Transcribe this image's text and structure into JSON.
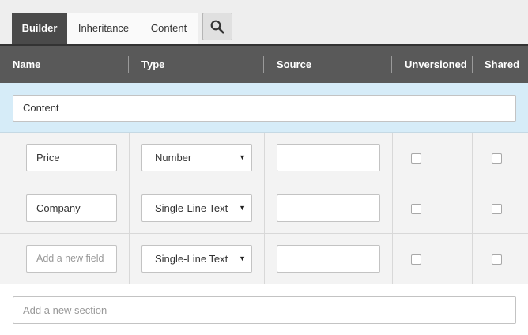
{
  "tabs": {
    "builder": "Builder",
    "inheritance": "Inheritance",
    "content": "Content"
  },
  "columns": {
    "name": "Name",
    "type": "Type",
    "source": "Source",
    "unversioned": "Unversioned",
    "shared": "Shared"
  },
  "section": {
    "name": "Content"
  },
  "fields": [
    {
      "name": "Price",
      "type": "Number",
      "source": "",
      "unversioned": false,
      "shared": false
    },
    {
      "name": "Company",
      "type": "Single-Line Text",
      "source": "",
      "unversioned": false,
      "shared": false
    },
    {
      "name": "",
      "name_placeholder": "Add a new field",
      "type": "Single-Line Text",
      "source": "",
      "unversioned": false,
      "shared": false
    }
  ],
  "add_section_placeholder": "Add a new section",
  "icons": {
    "search": "search-icon",
    "dropdown": "chevron-down-icon"
  },
  "colors": {
    "active_tab": "#4a4a4a",
    "header": "#595959",
    "section_bg": "#d6ecf8"
  }
}
